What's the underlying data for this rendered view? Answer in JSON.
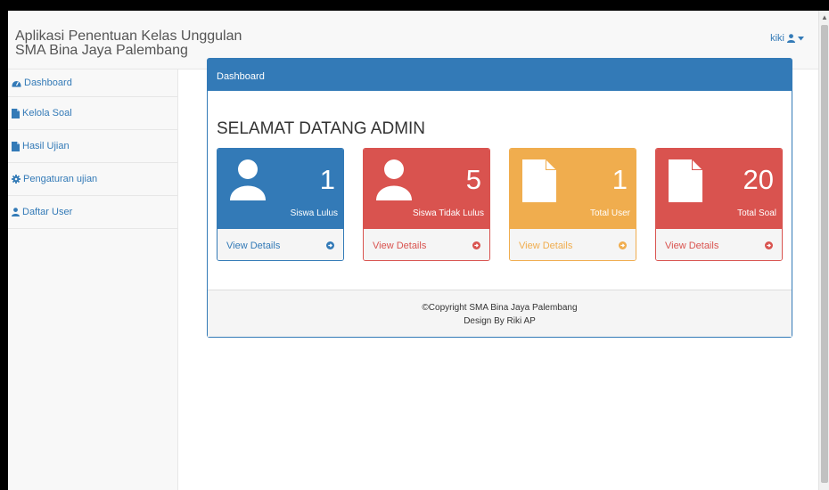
{
  "brand": {
    "line1": "Aplikasi Penentuan Kelas Unggulan",
    "line2": "SMA Bina Jaya Palembang"
  },
  "user_menu": {
    "username": "kiki",
    "icon": "user-icon",
    "caret": "caret-down-icon"
  },
  "sidebar": {
    "items": [
      {
        "label": "Dashboard",
        "icon": "dashboard-icon"
      },
      {
        "label": "Kelola Soal",
        "icon": "file-icon"
      },
      {
        "label": "Hasil Ujian",
        "icon": "file-icon"
      },
      {
        "label": "Pengaturan ujian",
        "icon": "gear-icon"
      },
      {
        "label": "Daftar User",
        "icon": "user-icon"
      }
    ]
  },
  "panel": {
    "heading": "Dashboard",
    "welcome": "SELAMAT DATANG ADMIN",
    "cards": [
      {
        "value": "1",
        "label": "Siswa Lulus",
        "link": "View Details",
        "color": "#337ab7",
        "icon": "user-icon"
      },
      {
        "value": "5",
        "label": "Siswa Tidak Lulus",
        "link": "View Details",
        "color": "#d9534f",
        "icon": "user-icon"
      },
      {
        "value": "1",
        "label": "Total User",
        "link": "View Details",
        "color": "#f0ad4e",
        "icon": "file-icon"
      },
      {
        "value": "20",
        "label": "Total Soal",
        "link": "View Details",
        "color": "#d9534f",
        "icon": "file-icon"
      }
    ],
    "footer": {
      "copyright": "©Copyright SMA Bina Jaya Palembang",
      "design": "Design By Riki AP"
    }
  },
  "colors": {
    "primary": "#337ab7",
    "danger": "#d9534f",
    "warning": "#f0ad4e",
    "sidebar_bg": "#f8f8f8"
  }
}
